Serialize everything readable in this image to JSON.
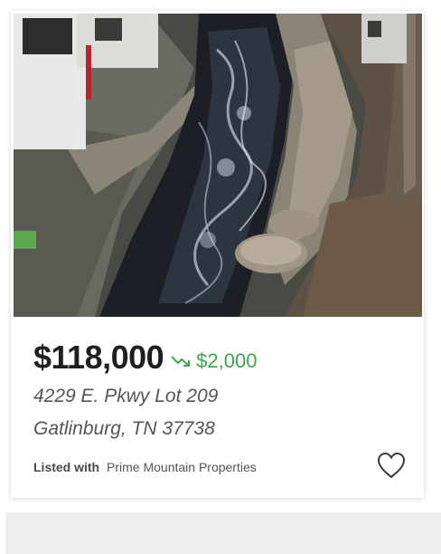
{
  "listing": {
    "price": "$118,000",
    "price_change": "$2,000",
    "price_change_icon": "trend-down-icon",
    "address_line1": "4229 E. Pkwy Lot 209",
    "address_line2": "Gatlinburg, TN 37738",
    "listed_with_label": "Listed with",
    "broker": "Prime Mountain Properties",
    "favorite_icon": "heart-outline-icon"
  },
  "colors": {
    "price": "#1f1f1f",
    "price_change": "#3aa64a",
    "text_secondary": "#555555",
    "footer_bar": "#efefef"
  }
}
